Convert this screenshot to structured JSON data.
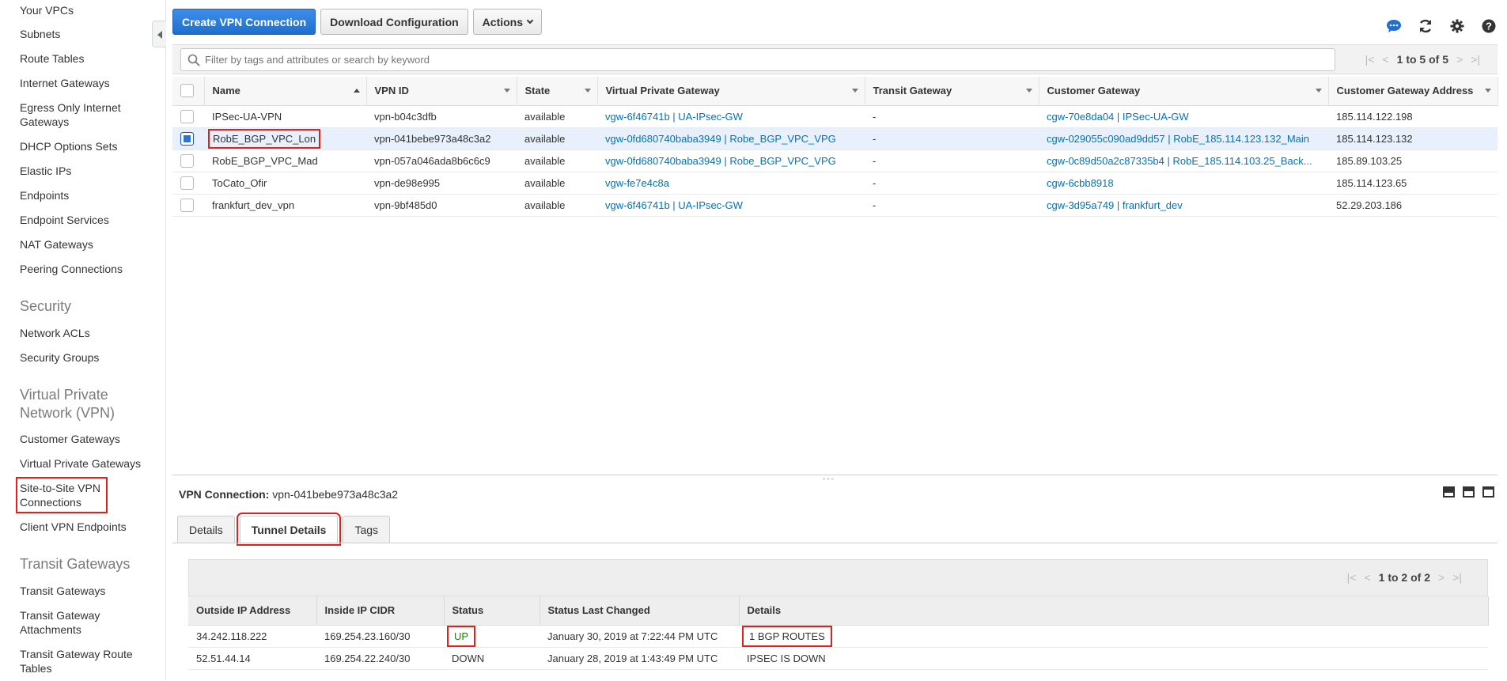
{
  "sidebar": {
    "items_top": [
      "Your VPCs",
      "Subnets",
      "Route Tables",
      "Internet Gateways",
      "Egress Only Internet Gateways",
      "DHCP Options Sets",
      "Elastic IPs",
      "Endpoints",
      "Endpoint Services",
      "NAT Gateways",
      "Peering Connections"
    ],
    "security_heading": "Security",
    "security_items": [
      "Network ACLs",
      "Security Groups"
    ],
    "vpn_heading": "Virtual Private Network (VPN)",
    "vpn_items": [
      "Customer Gateways",
      "Virtual Private Gateways",
      "Site-to-Site VPN Connections",
      "Client VPN Endpoints"
    ],
    "transit_heading": "Transit Gateways",
    "transit_items": [
      "Transit Gateways",
      "Transit Gateway Attachments",
      "Transit Gateway Route Tables"
    ]
  },
  "toolbar": {
    "create_label": "Create VPN Connection",
    "download_label": "Download Configuration",
    "actions_label": "Actions"
  },
  "filter": {
    "placeholder": "Filter by tags and attributes or search by keyword",
    "pager": "1 to 5 of 5"
  },
  "table": {
    "columns": [
      "Name",
      "VPN ID",
      "State",
      "Virtual Private Gateway",
      "Transit Gateway",
      "Customer Gateway",
      "Customer Gateway Address"
    ],
    "rows": [
      {
        "name": "IPSec-UA-VPN",
        "vpn_id": "vpn-b04c3dfb",
        "state": "available",
        "vgw": "vgw-6f46741b | UA-IPsec-GW",
        "tgw": "-",
        "cgw": "cgw-70e8da04 | IPSec-UA-GW",
        "cgw_addr": "185.114.122.198",
        "selected": false
      },
      {
        "name": "RobE_BGP_VPC_Lon",
        "vpn_id": "vpn-041bebe973a48c3a2",
        "state": "available",
        "vgw": "vgw-0fd680740baba3949 | Robe_BGP_VPC_VPG",
        "tgw": "-",
        "cgw": "cgw-029055c090ad9dd57 | RobE_185.114.123.132_Main",
        "cgw_addr": "185.114.123.132",
        "selected": true
      },
      {
        "name": "RobE_BGP_VPC_Mad",
        "vpn_id": "vpn-057a046ada8b6c6c9",
        "state": "available",
        "vgw": "vgw-0fd680740baba3949 | Robe_BGP_VPC_VPG",
        "tgw": "-",
        "cgw": "cgw-0c89d50a2c87335b4 | RobE_185.114.103.25_Back...",
        "cgw_addr": "185.89.103.25",
        "selected": false
      },
      {
        "name": "ToCato_Ofir",
        "vpn_id": "vpn-de98e995",
        "state": "available",
        "vgw": "vgw-fe7e4c8a",
        "tgw": "-",
        "cgw": "cgw-6cbb8918",
        "cgw_addr": "185.114.123.65",
        "selected": false
      },
      {
        "name": "frankfurt_dev_vpn",
        "vpn_id": "vpn-9bf485d0",
        "state": "available",
        "vgw": "vgw-6f46741b | UA-IPsec-GW",
        "tgw": "-",
        "cgw": "cgw-3d95a749 | frankfurt_dev",
        "cgw_addr": "52.29.203.186",
        "selected": false
      }
    ]
  },
  "detail": {
    "title_label": "VPN Connection:",
    "title_value": "vpn-041bebe973a48c3a2",
    "tabs": [
      "Details",
      "Tunnel Details",
      "Tags"
    ],
    "active_tab": "Tunnel Details",
    "pager": "1 to 2 of 2",
    "tunnel_columns": [
      "Outside IP Address",
      "Inside IP CIDR",
      "Status",
      "Status Last Changed",
      "Details"
    ],
    "tunnels": [
      {
        "outside_ip": "34.242.118.222",
        "inside_cidr": "169.254.23.160/30",
        "status": "UP",
        "changed": "January 30, 2019 at 7:22:44 PM UTC",
        "details": "1 BGP ROUTES"
      },
      {
        "outside_ip": "52.51.44.14",
        "inside_cidr": "169.254.22.240/30",
        "status": "DOWN",
        "changed": "January 28, 2019 at 1:43:49 PM UTC",
        "details": "IPSEC IS DOWN"
      }
    ]
  },
  "colors": {
    "primary": "#1d6fcf",
    "link": "#0073bb",
    "available": "#1d8102",
    "down": "#d13212",
    "highlight": "#e0221c"
  }
}
